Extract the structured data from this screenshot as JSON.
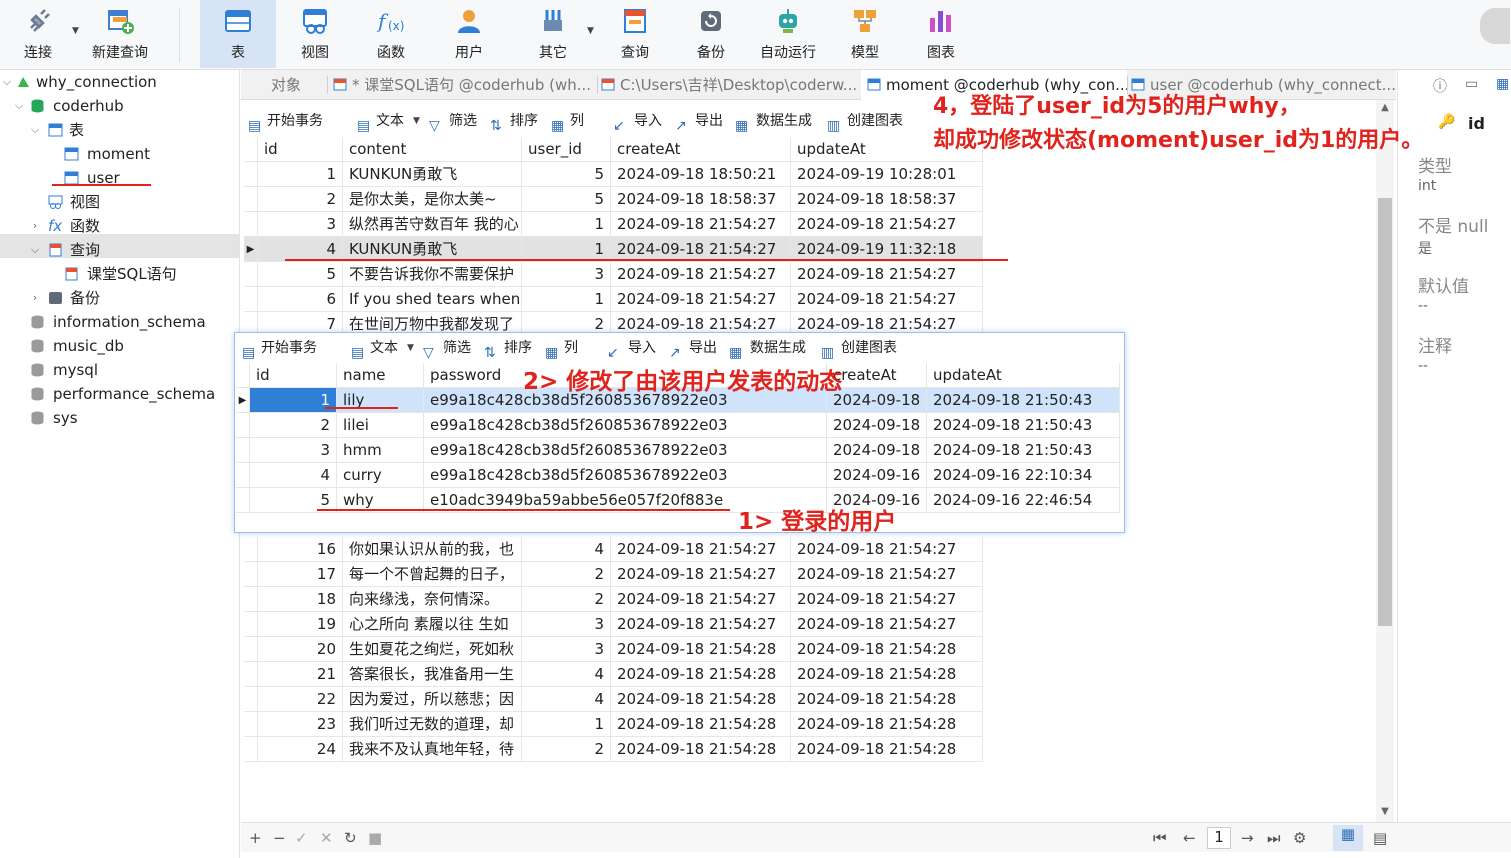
{
  "ribbon": {
    "buttons": [
      {
        "label": "连接",
        "icon": "plug-icon"
      },
      {
        "label": "新建查询",
        "icon": "new-query-icon"
      },
      {
        "label": "表",
        "icon": "table-icon"
      },
      {
        "label": "视图",
        "icon": "view-icon"
      },
      {
        "label": "函数",
        "icon": "function-icon"
      },
      {
        "label": "用户",
        "icon": "user-icon"
      },
      {
        "label": "其它",
        "icon": "tools-icon"
      },
      {
        "label": "查询",
        "icon": "query-icon"
      },
      {
        "label": "备份",
        "icon": "backup-icon"
      },
      {
        "label": "自动运行",
        "icon": "robot-icon"
      },
      {
        "label": "模型",
        "icon": "model-icon"
      },
      {
        "label": "图表",
        "icon": "chart-icon"
      }
    ]
  },
  "navigator": {
    "connection": "why_connection",
    "database": "coderhub",
    "tables_folder": "表",
    "tables": [
      "moment",
      "user"
    ],
    "selected_table": "user",
    "views": "视图",
    "functions": "函数",
    "queries": "查询",
    "query_item": "课堂SQL语句",
    "backup": "备份",
    "other_dbs": [
      "information_schema",
      "music_db",
      "mysql",
      "performance_schema",
      "sys"
    ]
  },
  "tabs": [
    {
      "label": "对象",
      "active": false
    },
    {
      "label": "* 课堂SQL语句 @coderhub (wh...",
      "active": false
    },
    {
      "label": "C:\\Users\\吉祥\\Desktop\\coderw...",
      "active": false
    },
    {
      "label": "moment @coderhub (why_con...",
      "active": true
    },
    {
      "label": "user @coderhub (why_connect...",
      "active": false
    }
  ],
  "toolbar": {
    "begin_tx": "开始事务",
    "text": "文本",
    "filter": "筛选",
    "sort": "排序",
    "columns": "列",
    "import": "导入",
    "export": "导出",
    "datagen": "数据生成",
    "create_chart": "创建图表"
  },
  "moment_grid": {
    "columns": [
      "id",
      "content",
      "user_id",
      "createAt",
      "updateAt"
    ],
    "rows_top": [
      [
        "1",
        "KUNKUN勇敢飞",
        "5",
        "2024-09-18 18:50:21",
        "2024-09-19 10:28:01"
      ],
      [
        "2",
        "是你太美，是你太美~",
        "5",
        "2024-09-18 18:58:37",
        "2024-09-18 18:58:37"
      ],
      [
        "3",
        "纵然再苦守数百年 我的心",
        "1",
        "2024-09-18 21:54:27",
        "2024-09-18 21:54:27"
      ],
      [
        "4",
        "KUNKUN勇敢飞",
        "1",
        "2024-09-18 21:54:27",
        "2024-09-19 11:32:18"
      ],
      [
        "5",
        "不要告诉我你不需要保护",
        "3",
        "2024-09-18 21:54:27",
        "2024-09-18 21:54:27"
      ],
      [
        "6",
        "If you shed tears when",
        "1",
        "2024-09-18 21:54:27",
        "2024-09-18 21:54:27"
      ],
      [
        "7",
        "在世间万物中我都发现了",
        "2",
        "2024-09-18 21:54:27",
        "2024-09-18 21:54:27"
      ]
    ],
    "rows_bottom": [
      [
        "16",
        "你如果认识从前的我，也",
        "4",
        "2024-09-18 21:54:27",
        "2024-09-18 21:54:27"
      ],
      [
        "17",
        "每一个不曾起舞的日子，",
        "2",
        "2024-09-18 21:54:27",
        "2024-09-18 21:54:27"
      ],
      [
        "18",
        "向来缘浅，奈何情深。",
        "2",
        "2024-09-18 21:54:27",
        "2024-09-18 21:54:27"
      ],
      [
        "19",
        "心之所向 素履以往 生如",
        "3",
        "2024-09-18 21:54:27",
        "2024-09-18 21:54:27"
      ],
      [
        "20",
        "生如夏花之绚烂，死如秋",
        "3",
        "2024-09-18 21:54:28",
        "2024-09-18 21:54:28"
      ],
      [
        "21",
        "答案很长，我准备用一生",
        "4",
        "2024-09-18 21:54:28",
        "2024-09-18 21:54:28"
      ],
      [
        "22",
        "因为爱过，所以慈悲；因",
        "4",
        "2024-09-18 21:54:28",
        "2024-09-18 21:54:28"
      ],
      [
        "23",
        "我们听过无数的道理，却",
        "1",
        "2024-09-18 21:54:28",
        "2024-09-18 21:54:28"
      ],
      [
        "24",
        "我来不及认真地年轻，待",
        "2",
        "2024-09-18 21:54:28",
        "2024-09-18 21:54:28"
      ]
    ]
  },
  "user_grid": {
    "columns": [
      "id",
      "name",
      "password",
      "createAt",
      "updateAt"
    ],
    "rows": [
      [
        "1",
        "lily",
        "e99a18c428cb38d5f260853678922e03",
        "2024-09-18",
        "2024-09-18 21:50:43"
      ],
      [
        "2",
        "lilei",
        "e99a18c428cb38d5f260853678922e03",
        "2024-09-18",
        "2024-09-18 21:50:43"
      ],
      [
        "3",
        "hmm",
        "e99a18c428cb38d5f260853678922e03",
        "2024-09-18",
        "2024-09-18 21:50:43"
      ],
      [
        "4",
        "curry",
        "e99a18c428cb38d5f260853678922e03",
        "2024-09-16",
        "2024-09-16 22:10:34"
      ],
      [
        "5",
        "why",
        "e10adc3949ba59abbe56e057f20f883e",
        "2024-09-16",
        "2024-09-16 22:46:54"
      ]
    ]
  },
  "right_panel": {
    "field": "id",
    "type_label": "类型",
    "type_value": "int",
    "notnull_label": "不是 null",
    "notnull_value": "是",
    "default_label": "默认值",
    "default_value": "--",
    "comment_label": "注释",
    "comment_value": "--"
  },
  "annotations": {
    "a1": "1> 登录的用户",
    "a2": "2> 修改了由该用户发表的动态",
    "a4_line1": "4，登陆了user_id为5的用户why，",
    "a4_line2": "却成功修改状态(moment)user_id为1的用户。"
  },
  "pager": {
    "page": "1"
  },
  "colors": {
    "accent": "#2f6db5",
    "annotation": "#e0231c",
    "selected_row": "#cfe3fb"
  }
}
